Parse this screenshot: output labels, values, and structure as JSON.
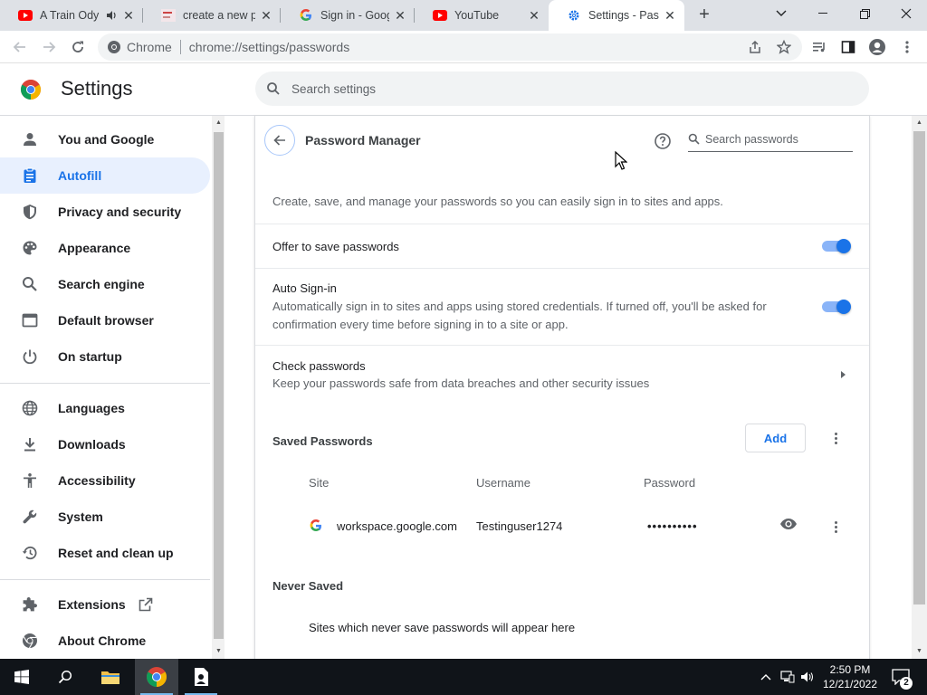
{
  "browser": {
    "tabs": [
      {
        "title": "A Train Ody",
        "favicon": "youtube-icon",
        "muted_icon": "speaker-icon"
      },
      {
        "title": "create a new pa",
        "favicon": "search-thumb-icon"
      },
      {
        "title": "Sign in - Google",
        "favicon": "google-icon"
      },
      {
        "title": "YouTube",
        "favicon": "youtube-icon"
      },
      {
        "title": "Settings - Passw",
        "favicon": "gear-icon",
        "active": true
      }
    ],
    "new_tab": "+",
    "omnibox": {
      "chip": "Chrome",
      "url": "chrome://settings/passwords"
    }
  },
  "settings": {
    "title": "Settings",
    "search_placeholder": "Search settings",
    "nav": [
      {
        "label": "You and Google",
        "icon": "person-icon"
      },
      {
        "label": "Autofill",
        "icon": "clipboard-icon",
        "active": true
      },
      {
        "label": "Privacy and security",
        "icon": "shield-icon"
      },
      {
        "label": "Appearance",
        "icon": "palette-icon"
      },
      {
        "label": "Search engine",
        "icon": "search-icon"
      },
      {
        "label": "Default browser",
        "icon": "browser-icon"
      },
      {
        "label": "On startup",
        "icon": "power-icon"
      },
      {
        "label": "Languages",
        "icon": "globe-icon"
      },
      {
        "label": "Downloads",
        "icon": "download-icon"
      },
      {
        "label": "Accessibility",
        "icon": "accessibility-icon"
      },
      {
        "label": "System",
        "icon": "wrench-icon"
      },
      {
        "label": "Reset and clean up",
        "icon": "history-icon"
      },
      {
        "label": "Extensions",
        "icon": "puzzle-icon"
      },
      {
        "label": "About Chrome",
        "icon": "chrome-icon"
      }
    ]
  },
  "password_manager": {
    "title": "Password Manager",
    "search_placeholder": "Search passwords",
    "description": "Create, save, and manage your passwords so you can easily sign in to sites and apps.",
    "offer_to_save": {
      "label": "Offer to save passwords",
      "enabled": true
    },
    "auto_signin": {
      "label": "Auto Sign-in",
      "description": "Automatically sign in to sites and apps using stored credentials. If turned off, you'll be asked for confirmation every time before signing in to a site or app.",
      "enabled": true
    },
    "check_passwords": {
      "label": "Check passwords",
      "description": "Keep your passwords safe from data breaches and other security issues"
    },
    "saved_passwords": {
      "heading": "Saved Passwords",
      "add_label": "Add",
      "columns": {
        "site": "Site",
        "username": "Username",
        "password": "Password"
      },
      "entries": [
        {
          "site": "workspace.google.com",
          "username": "Testinguser1274",
          "password": "••••••••••"
        }
      ]
    },
    "never_saved": {
      "heading": "Never Saved",
      "empty_text": "Sites which never save passwords will appear here"
    }
  },
  "taskbar": {
    "time": "2:50 PM",
    "date": "12/21/2022",
    "notifications": "2"
  },
  "colors": {
    "accent": "#1a73e8",
    "active_nav_bg": "#e8f0fe",
    "taskbar": "#101419"
  }
}
